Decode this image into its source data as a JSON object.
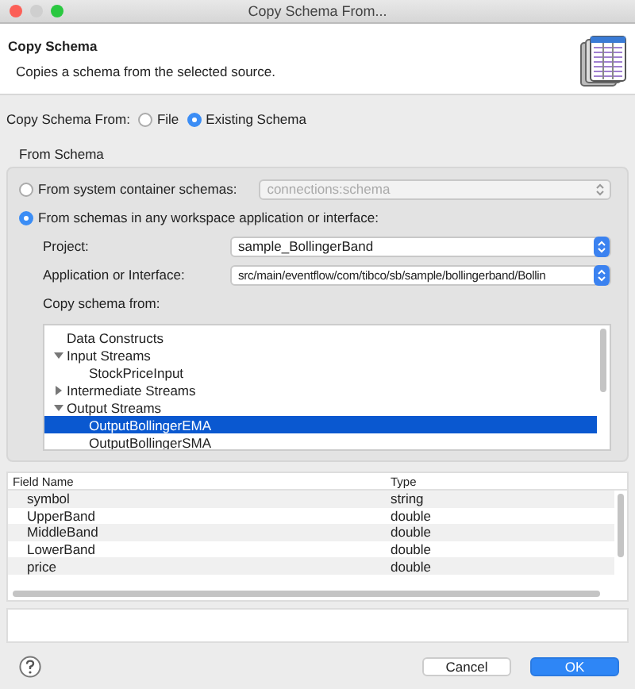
{
  "window": {
    "title": "Copy Schema From..."
  },
  "header": {
    "title": "Copy Schema",
    "description": "Copies a schema from the selected source."
  },
  "source": {
    "label": "Copy Schema From:",
    "options": [
      {
        "label": "File",
        "selected": false
      },
      {
        "label": "Existing Schema",
        "selected": true
      }
    ]
  },
  "from_schema": {
    "title": "From Schema",
    "system": {
      "label": "From system container schemas:",
      "selected": false,
      "value": "connections:schema",
      "disabled": true
    },
    "workspace": {
      "label": "From schemas in any workspace application or interface:",
      "selected": true
    },
    "project": {
      "label": "Project:",
      "value": "sample_BollingerBand"
    },
    "application": {
      "label": "Application or Interface:",
      "value": "src/main/eventflow/com/tibco/sb/sample/bollingerband/Bollin"
    },
    "tree_label": "Copy schema from:",
    "tree": [
      {
        "label": "Data Constructs",
        "selected": false
      },
      {
        "label": "Input Streams",
        "expanded": true,
        "selected": false,
        "children": [
          {
            "label": "StockPriceInput",
            "selected": false
          }
        ]
      },
      {
        "label": "Intermediate Streams",
        "expanded": false,
        "selected": false
      },
      {
        "label": "Output Streams",
        "expanded": true,
        "selected": false,
        "children": [
          {
            "label": "OutputBollingerEMA",
            "selected": true
          },
          {
            "label": "OutputBollingerSMA",
            "selected": false
          }
        ]
      }
    ]
  },
  "table": {
    "columns": [
      "Field Name",
      "Type"
    ],
    "rows": [
      [
        "symbol",
        "string"
      ],
      [
        "UpperBand",
        "double"
      ],
      [
        "MiddleBand",
        "double"
      ],
      [
        "LowerBand",
        "double"
      ],
      [
        "price",
        "double"
      ]
    ]
  },
  "buttons": [
    {
      "label": "Cancel",
      "default": false
    },
    {
      "label": "OK",
      "default": true
    }
  ]
}
